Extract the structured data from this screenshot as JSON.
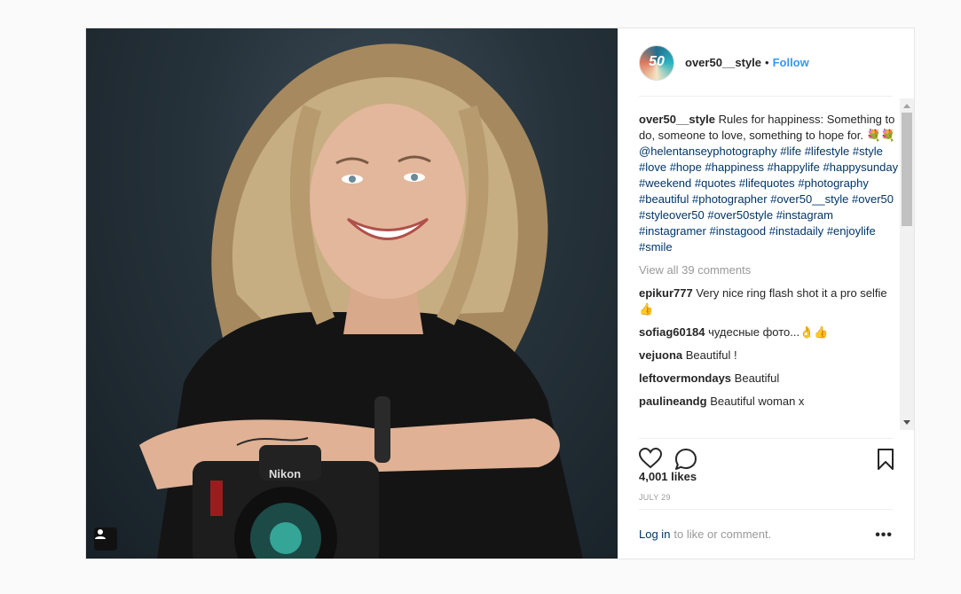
{
  "post": {
    "username": "over50__style",
    "separator": "•",
    "follow_label": "Follow",
    "avatar_text": "50"
  },
  "caption": {
    "username": "over50__style",
    "text_part1": "Rules for happiness: Something to do, someone to love, something to hope for. 💐💐",
    "tags": [
      "@helentanseyphotography",
      "#life",
      "#lifestyle",
      "#style",
      "#love",
      "#hope",
      "#happiness",
      "#happylife",
      "#happysunday",
      "#weekend",
      "#quotes",
      "#lifequotes",
      "#photography",
      "#beautiful",
      "#photographer",
      "#over50__style",
      "#over50",
      "#styleover50",
      "#over50style",
      "#instagram",
      "#instagramer",
      "#instagood",
      "#instadaily",
      "#enjoylife",
      "#smile"
    ]
  },
  "view_all": "View all 39 comments",
  "comments": [
    {
      "user": "epikur777",
      "text": "Very nice ring flash shot it a pro selfie 👍"
    },
    {
      "user": "sofiag60184",
      "text": "чудесные фото...👌👍"
    },
    {
      "user": "vejuona",
      "text": "Beautiful !"
    },
    {
      "user": "leftovermondays",
      "text": "Beautiful"
    },
    {
      "user": "paulineandg",
      "text": "Beautiful woman x"
    }
  ],
  "likes": "4,001 likes",
  "date": "JULY 29",
  "login_link": "Log in",
  "login_rest": "to like or comment.",
  "more_label": "•••",
  "icons": {
    "like": "heart-icon",
    "comment": "comment-bubble-icon",
    "save": "bookmark-icon",
    "tagged": "person-tag-icon"
  }
}
